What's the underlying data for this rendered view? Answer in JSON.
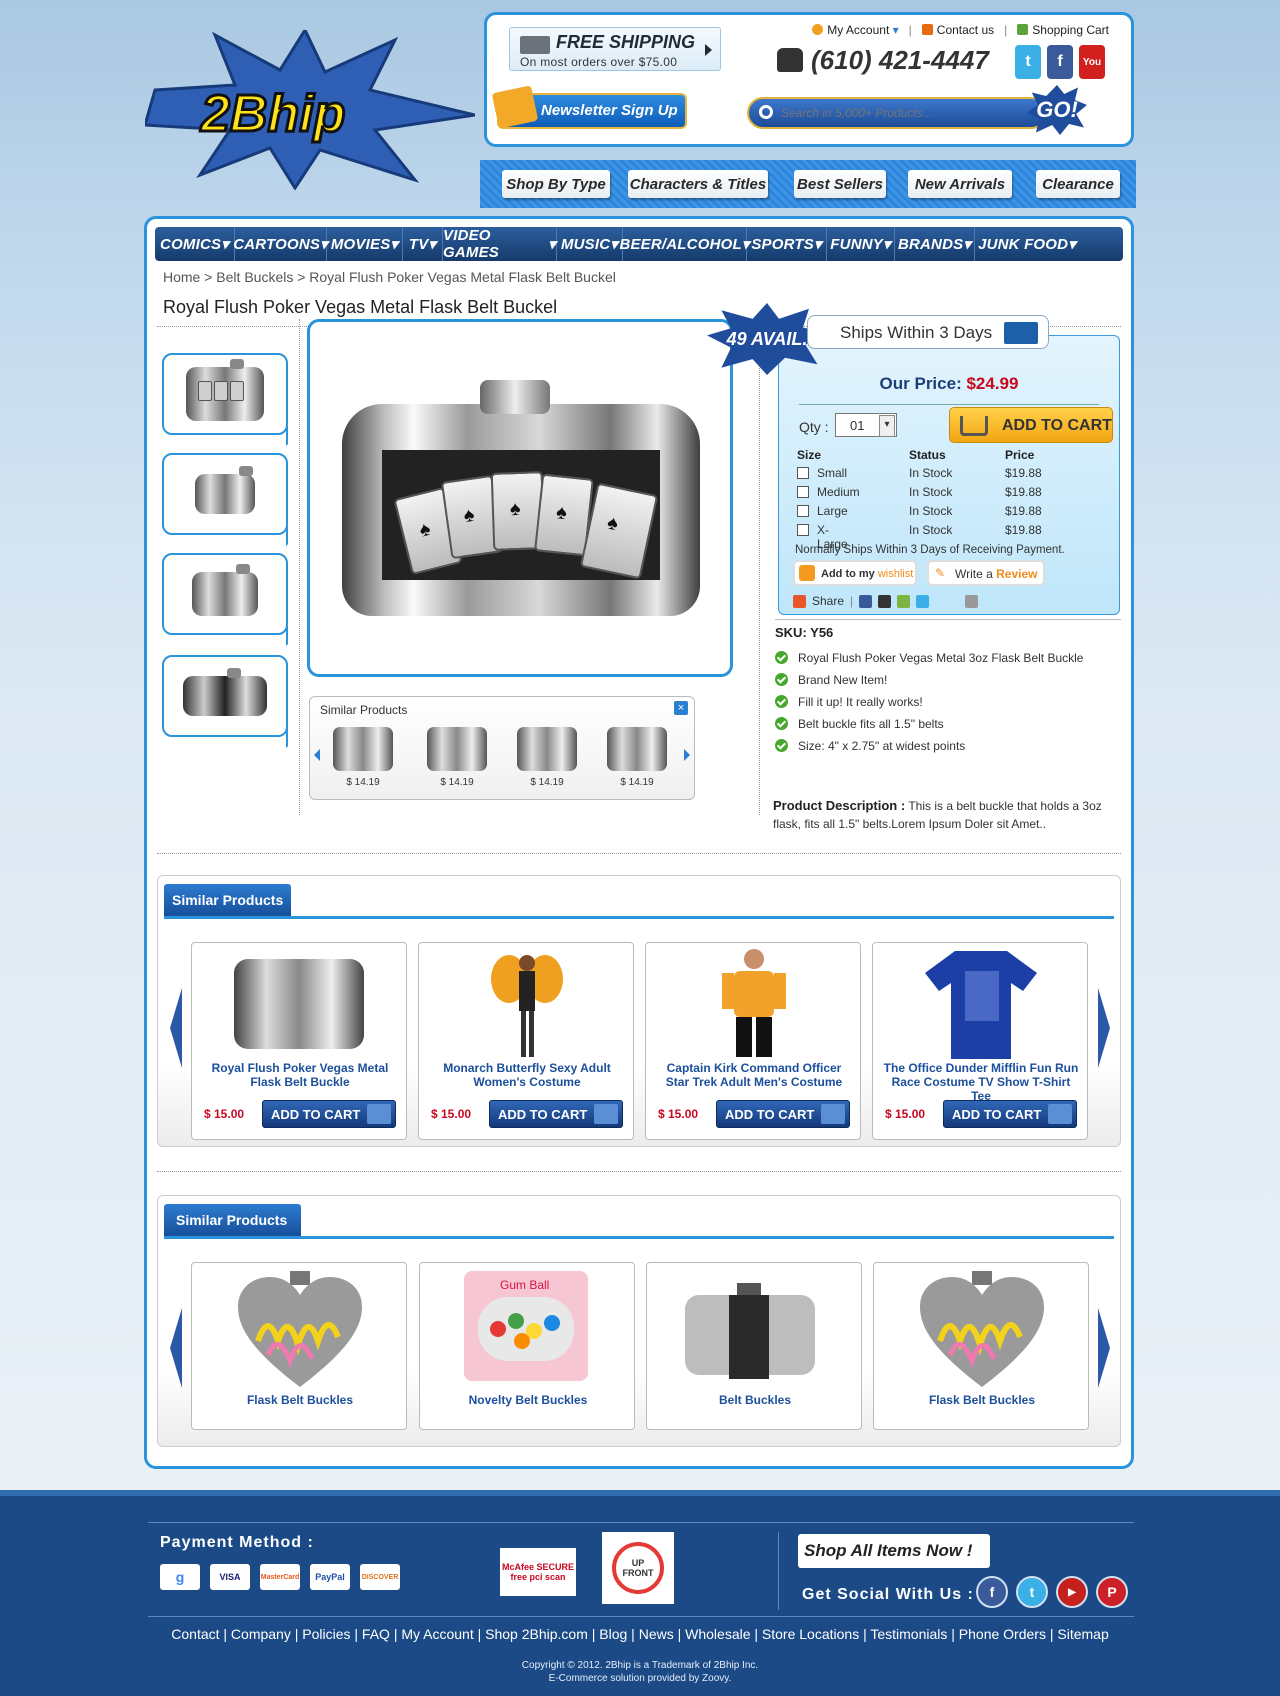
{
  "header": {
    "logo_text": "2Bhip",
    "free_shipping": {
      "title": "FREE SHIPPING",
      "sub": "On most orders over $75.00"
    },
    "top_links": [
      "My Account",
      "Contact us",
      "Shopping Cart"
    ],
    "phone": "(610) 421-4447",
    "newsletter_label": "Newsletter Sign Up",
    "search_placeholder": "Search in 5,000+ Products...",
    "go_label": "GO!",
    "type_tabs": [
      "Shop By Type",
      "Characters & Titles",
      "Best Sellers",
      "New Arrivals",
      "Clearance"
    ]
  },
  "category_nav": [
    "COMICS",
    "CARTOONS",
    "MOVIES",
    "TV",
    "VIDEO GAMES",
    "MUSIC",
    "BEER/ALCOHOL",
    "SPORTS",
    "FUNNY",
    "BRANDS",
    "JUNK FOOD"
  ],
  "breadcrumb": "Home > Belt  Buckels > Royal Flush Poker Vegas Metal Flask Belt Buckel",
  "product": {
    "title": "Royal Flush Poker Vegas Metal Flask Belt Buckel",
    "avail": "49 AVAIL.",
    "ships": "Ships Within 3 Days",
    "our_price_label": "Our Price:",
    "our_price": "$24.99",
    "qty_label": "Qty :",
    "qty_value": "01",
    "add_to_cart": "ADD TO CART",
    "size_headers": [
      "Size",
      "Status",
      "Price"
    ],
    "sizes": [
      {
        "size": "Small",
        "status": "In Stock",
        "price": "$19.88"
      },
      {
        "size": "Medium",
        "status": "In Stock",
        "price": "$19.88"
      },
      {
        "size": "Large",
        "status": "In Stock",
        "price": "$19.88"
      },
      {
        "size": "X-Large",
        "status": "In Stock",
        "price": "$19.88"
      }
    ],
    "ship_note": "Normally Ships Within 3 Days of Receiving Payment.",
    "wishlist_prefix": "Add to my",
    "wishlist_word": "wishlist",
    "review_prefix": "Write a",
    "review_word": "Review",
    "share": "Share",
    "sku": "SKU: Y56",
    "features": [
      "Royal Flush Poker Vegas Metal 3oz Flask Belt Buckle",
      "Brand New Item!",
      "Fill it up! It really works!",
      "Belt buckle fits all 1.5\" belts",
      "Size: 4\" x 2.75\" at widest points"
    ],
    "description_label": "Product Description :",
    "description": "This is a belt buckle that holds a 3oz flask, fits all 1.5\" belts.Lorem Ipsum Doler sit Amet.."
  },
  "mini_similar": {
    "title": "Similar Products",
    "close": "×",
    "prices": [
      "$ 14.19",
      "$ 14.19",
      "$ 14.19",
      "$ 14.19"
    ]
  },
  "similar1": {
    "title": "Similar Products",
    "items": [
      {
        "name": "Royal Flush Poker Vegas Metal Flask Belt Buckle",
        "price": "$ 15.00",
        "btn": "ADD TO CART"
      },
      {
        "name": "Monarch Butterfly Sexy Adult Women's Costume",
        "price": "$ 15.00",
        "btn": "ADD TO CART"
      },
      {
        "name": "Captain Kirk Command Officer Star Trek Adult Men's Costume",
        "price": "$ 15.00",
        "btn": "ADD TO CART"
      },
      {
        "name": "The Office Dunder Mifflin Fun Run Race Costume TV Show T-Shirt Tee",
        "price": "$ 15.00",
        "btn": "ADD TO CART"
      }
    ]
  },
  "similar2": {
    "title": "Similar Products",
    "items": [
      {
        "name": "Flask Belt Buckles"
      },
      {
        "name": "Novelty Belt Buckles",
        "label_on_image": "Gum Ball"
      },
      {
        "name": "Belt Buckles"
      },
      {
        "name": "Flask Belt Buckles"
      }
    ]
  },
  "footer": {
    "payment_label": "Payment Method :",
    "cards": [
      "VISA",
      "MasterCard",
      "PayPal",
      "DISCOVER"
    ],
    "seal1": "McAfee SECURE free pci scan",
    "seal2": "UP FRONT",
    "shop_all": "Shop All Items Now !",
    "get_social": "Get Social With Us :",
    "links": "Contact | Company | Policies | FAQ | My Account | Shop 2Bhip.com | Blog | News | Wholesale | Store Locations | Testimonials | Phone Orders | Sitemap",
    "copyright": "Copyright © 2012. 2Bhip is a Trademark of 2Bhip Inc.",
    "ecommerce": "E-Commerce solution provided by Zoovy."
  },
  "colors": {
    "accent": "#2a93dc",
    "nav": "#1b4a86",
    "price_red": "#c8081f",
    "link_blue": "#1c4f9c"
  }
}
